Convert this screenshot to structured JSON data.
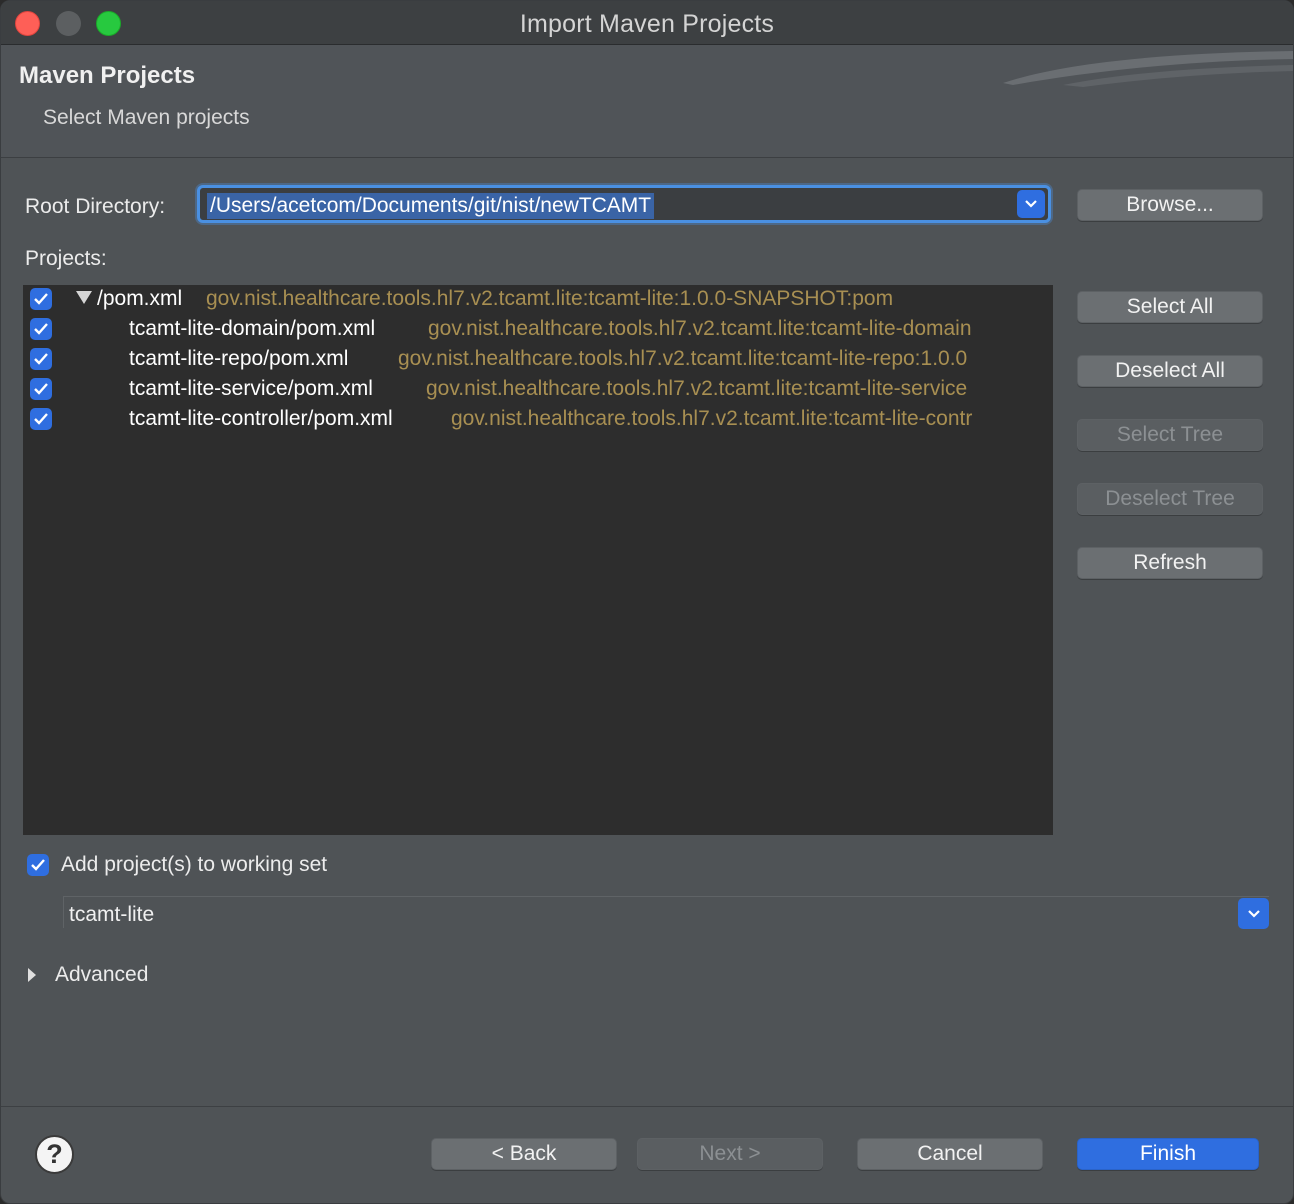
{
  "window": {
    "title": "Import Maven Projects"
  },
  "banner": {
    "title": "Maven Projects",
    "subtitle": "Select Maven projects"
  },
  "root_directory": {
    "label": "Root Directory:",
    "value": "/Users/acetcom/Documents/git/nist/newTCAMT"
  },
  "browse_label": "Browse...",
  "projects_label": "Projects:",
  "projects": [
    {
      "name": "/pom.xml",
      "coords": "gov.nist.healthcare.tools.hl7.v2.tcamt.lite:tcamt-lite:1.0.0-SNAPSHOT:pom",
      "checked": true
    },
    {
      "name": "tcamt-lite-domain/pom.xml",
      "coords": "gov.nist.healthcare.tools.hl7.v2.tcamt.lite:tcamt-lite-domain",
      "checked": true
    },
    {
      "name": "tcamt-lite-repo/pom.xml",
      "coords": "gov.nist.healthcare.tools.hl7.v2.tcamt.lite:tcamt-lite-repo:1.0.0",
      "checked": true
    },
    {
      "name": "tcamt-lite-service/pom.xml",
      "coords": "gov.nist.healthcare.tools.hl7.v2.tcamt.lite:tcamt-lite-service",
      "checked": true
    },
    {
      "name": "tcamt-lite-controller/pom.xml",
      "coords": "gov.nist.healthcare.tools.hl7.v2.tcamt.lite:tcamt-lite-contr",
      "checked": true
    }
  ],
  "side_buttons": {
    "select_all": "Select All",
    "deselect_all": "Deselect All",
    "select_tree": "Select Tree",
    "deselect_tree": "Deselect Tree",
    "refresh": "Refresh"
  },
  "working_set": {
    "label": "Add project(s) to working set",
    "checked": true,
    "value": "tcamt-lite"
  },
  "advanced_label": "Advanced",
  "footer": {
    "back": "< Back",
    "next": "Next >",
    "cancel": "Cancel",
    "finish": "Finish"
  },
  "colors": {
    "accent": "#2f6ee0",
    "coords_text": "#a88f52",
    "tree_bg": "#2d2d2d",
    "dialog_bg": "#4f5356"
  }
}
